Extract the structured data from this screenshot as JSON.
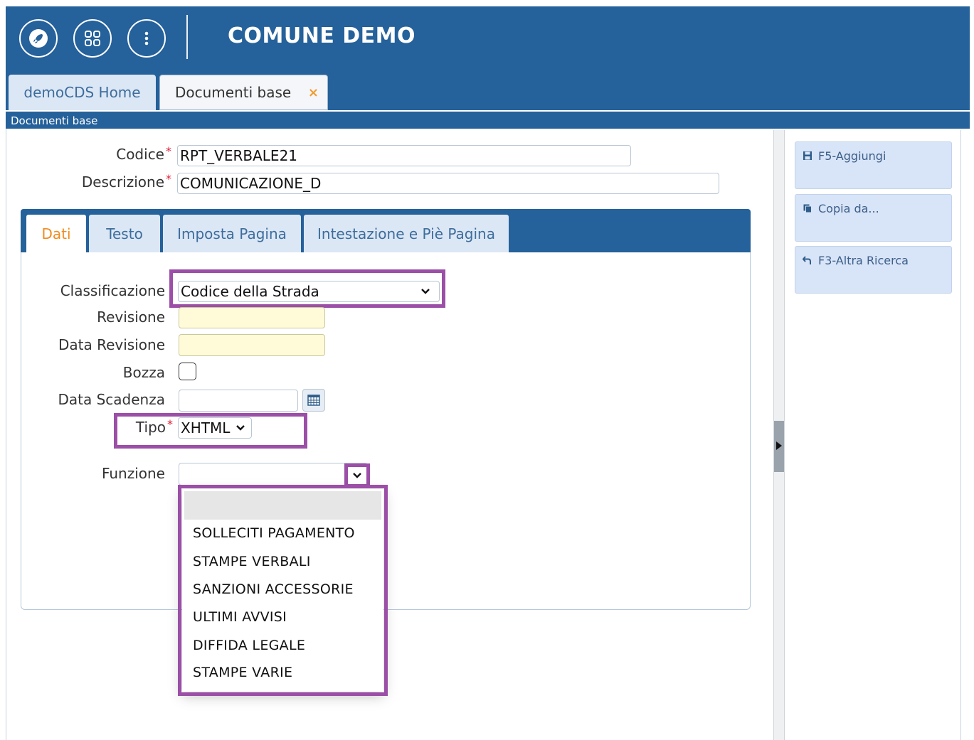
{
  "header": {
    "title": "COMUNE DEMO",
    "buttons": [
      {
        "icon": "rocket-icon"
      },
      {
        "icon": "grid-apps-icon"
      },
      {
        "icon": "more-vertical-icon"
      }
    ]
  },
  "app_tabs": [
    {
      "label": "demoCDS Home",
      "active": false
    },
    {
      "label": "Documenti base",
      "active": true,
      "close": "×"
    }
  ],
  "breadcrumb": "Documenti base",
  "form": {
    "codice": {
      "label": "Codice",
      "value": "RPT_VERBALE21",
      "required": "*"
    },
    "descrizione": {
      "label": "Descrizione",
      "value": "COMUNICAZIONE_D",
      "required": "*"
    }
  },
  "inner_tabs": [
    {
      "label": "Dati",
      "active": true
    },
    {
      "label": "Testo",
      "active": false
    },
    {
      "label": "Imposta Pagina",
      "active": false
    },
    {
      "label": "Intestazione e Piè Pagina",
      "active": false
    }
  ],
  "dati": {
    "classificazione": {
      "label": "Classificazione",
      "value": "Codice della Strada"
    },
    "revisione": {
      "label": "Revisione",
      "value": ""
    },
    "data_revisione": {
      "label": "Data Revisione",
      "value": ""
    },
    "bozza": {
      "label": "Bozza",
      "checked": false
    },
    "data_scadenza": {
      "label": "Data Scadenza",
      "value": ""
    },
    "tipo": {
      "label": "Tipo",
      "value": "XHTML",
      "required": "*"
    },
    "funzione": {
      "label": "Funzione",
      "value": ""
    }
  },
  "funzione_options": [
    "",
    "SOLLECITI PAGAMENTO",
    "STAMPE VERBALI",
    "SANZIONI ACCESSORIE",
    "ULTIMI AVVISI",
    "DIFFIDA LEGALE",
    "STAMPE VARIE"
  ],
  "actions": [
    {
      "label": "F5-Aggiungi",
      "icon": "save-icon"
    },
    {
      "label": "Copia da...",
      "icon": "copy-icon"
    },
    {
      "label": "F3-Altra Ricerca",
      "icon": "back-arrow-icon"
    }
  ],
  "colors": {
    "header_bg": "#25619a",
    "highlight": "#9b4fa7",
    "active_tab_text": "#f08c1f",
    "required": "#e0203a",
    "readonly_field": "#fffbd8"
  }
}
